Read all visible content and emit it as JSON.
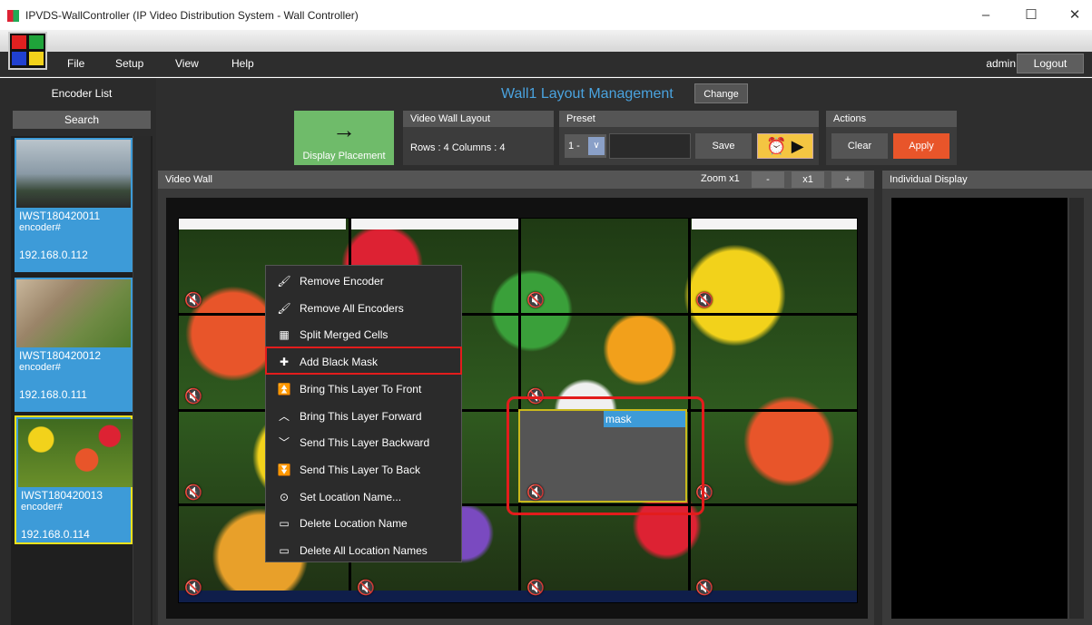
{
  "window": {
    "title": "IPVDS-WallController (IP Video Distribution System - Wall Controller)",
    "minimize": "–",
    "maximize": "☐",
    "close": "✕"
  },
  "menu": {
    "file": "File",
    "setup": "Setup",
    "view": "View",
    "help": "Help"
  },
  "user": {
    "name": "admin",
    "logout": "Logout"
  },
  "encoders": {
    "title": "Encoder List",
    "search": "Search",
    "items": [
      {
        "name": "IWST180420011",
        "sub": "encoder#",
        "ip": "192.168.0.112"
      },
      {
        "name": "IWST180420012",
        "sub": "encoder#",
        "ip": "192.168.0.111"
      },
      {
        "name": "IWST180420013",
        "sub": "encoder#",
        "ip": "192.168.0.114"
      }
    ]
  },
  "layout": {
    "title": "Wall1 Layout Management",
    "change": "Change",
    "display_placement": "Display Placement",
    "video_wall_layout": "Video Wall Layout",
    "rows_columns": "Rows :  4   Columns :  4",
    "preset": "Preset",
    "preset_value": "1 -",
    "save": "Save",
    "actions": "Actions",
    "clear": "Clear",
    "apply": "Apply"
  },
  "videowall": {
    "header": "Video Wall",
    "zoom": "Zoom x1",
    "zoom_minus": "-",
    "zoom_x1": "x1",
    "zoom_plus": "+",
    "mask_label": "mask"
  },
  "individual": {
    "header": "Individual Display"
  },
  "context_menu": [
    {
      "icon": "brush-icon",
      "glyph": "🖌",
      "label": "Remove Encoder"
    },
    {
      "icon": "brush-icon",
      "glyph": "🖌",
      "label": "Remove All Encoders"
    },
    {
      "icon": "grid-icon",
      "glyph": "▦",
      "label": "Split Merged Cells"
    },
    {
      "icon": "plus-icon",
      "glyph": "✚",
      "label": "Add Black Mask"
    },
    {
      "icon": "double-up-icon",
      "glyph": "⏫",
      "label": "Bring This Layer To Front"
    },
    {
      "icon": "chevron-up-icon",
      "glyph": "︿",
      "label": "Bring This Layer Forward"
    },
    {
      "icon": "chevron-down-icon",
      "glyph": "﹀",
      "label": "Send This Layer Backward"
    },
    {
      "icon": "double-down-icon",
      "glyph": "⏬",
      "label": "Send This Layer To Back"
    },
    {
      "icon": "location-pin-icon",
      "glyph": "⊙",
      "label": "Set Location Name..."
    },
    {
      "icon": "minus-icon",
      "glyph": "▭",
      "label": "Delete Location Name"
    },
    {
      "icon": "minus-icon",
      "glyph": "▭",
      "label": "Delete All Location Names"
    }
  ]
}
